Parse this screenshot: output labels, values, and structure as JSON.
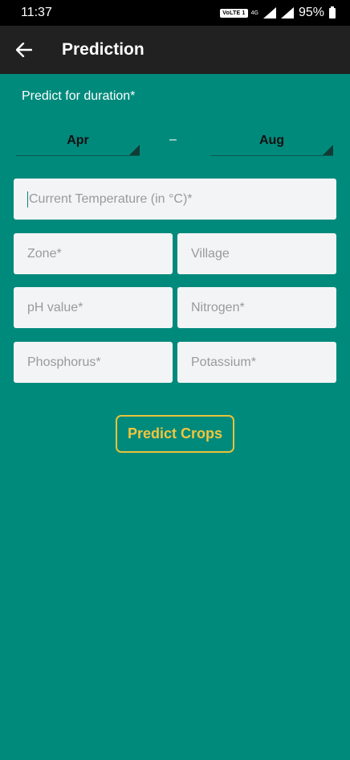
{
  "status_bar": {
    "time": "11:37",
    "volte_label": "VoLTE 1",
    "network_label": "4G",
    "battery_percent": "95%"
  },
  "app_bar": {
    "title": "Prediction",
    "back_icon": "arrow-left-icon"
  },
  "form": {
    "duration_label": "Predict for duration*",
    "from_month": "Apr",
    "separator": "–",
    "to_month": "Aug",
    "temperature_placeholder": "Current Temperature (in °C)*",
    "zone_placeholder": "Zone*",
    "village_placeholder": "Village",
    "ph_placeholder": "pH value*",
    "nitrogen_placeholder": "Nitrogen*",
    "phosphorus_placeholder": "Phosphorus*",
    "potassium_placeholder": "Potassium*",
    "submit_label": "Predict Crops"
  },
  "colors": {
    "background": "#008a7c",
    "app_bar": "#212121",
    "field_bg": "#f3f4f6",
    "button_accent": "#e8c23a"
  }
}
